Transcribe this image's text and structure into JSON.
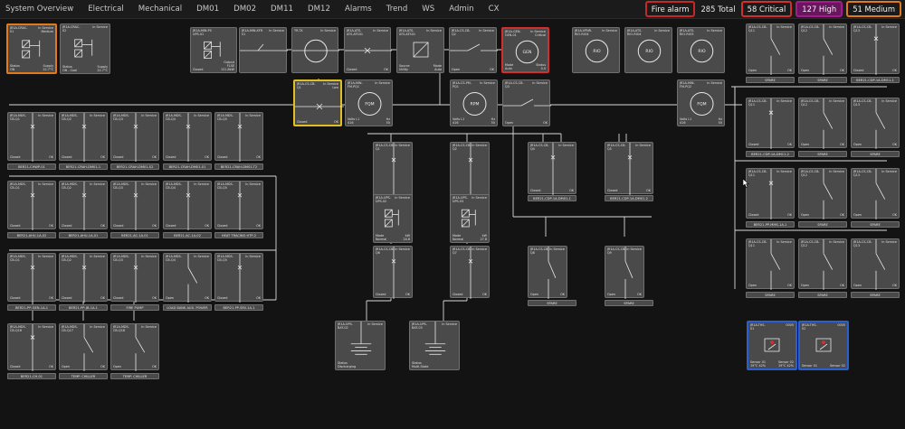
{
  "nav": {
    "items": [
      "System Overview",
      "Electrical",
      "Mechanical",
      "DM01",
      "DM02",
      "DM11",
      "DM12",
      "Alarms",
      "Trend",
      "WS",
      "Admin",
      "CX"
    ]
  },
  "alarms": {
    "fire": "Fire alarm",
    "total": "285 Total",
    "critical": "58 Critical",
    "high": "127 High",
    "medium": "51 Medium"
  },
  "colors": {
    "background": "#131313",
    "tile": "#4a4a4a",
    "wire": "#d8d8d8",
    "critical": "#d32f2f",
    "high": "#a01d8a",
    "medium": "#e07a1a",
    "selected": "#e0c020",
    "sensor": "#2a5fd0"
  },
  "common": {
    "in_service": "In Service",
    "closed": "Closed",
    "open": "Open",
    "ok": "OK",
    "spare": "SPARE"
  },
  "tiles": {
    "crac1": {
      "title": "JR1A-CRAC-\n01",
      "status": "In Service\nMedium",
      "bl": "Status\nON",
      "br": "Supply\n22.7°C"
    },
    "crac2": {
      "title": "JR1A-CRAC-\n02",
      "status": "In Service",
      "bl": "Status\nON - Cool",
      "br": "Supply\n22.7°C"
    },
    "ups": {
      "title": "JR1A-MIN-PS\nUPS-01",
      "status": "",
      "bl": "Closed",
      "br": "Output\nFLSE\n121.8kW"
    },
    "xfmr": {
      "title": "JR1A-MIN-XFR\n01",
      "status": "In Service",
      "bl": "",
      "br": ""
    },
    "tx": {
      "title": "TR-TX",
      "status": "In Service",
      "bl": "",
      "br": ""
    },
    "ats": {
      "title": "JR1A-ATS-\nATS-ATS01",
      "status": "In Service",
      "bl": "Closed",
      "br": "OK"
    },
    "ats2": {
      "title": "JR1A-ATS-\nATS-ATS01",
      "status": "In Service",
      "bl": "Source\nUtility",
      "br": "Mode\nAuto"
    },
    "cbq2": {
      "title": "JR1A-CS-CB-\nQ2",
      "status": "In Service",
      "bl": "Open",
      "br": "OK"
    },
    "gen": {
      "title": "JR1A-GEN-\nGEN-01",
      "status": "In Service\nCritical",
      "bl": "Mode\nAuto",
      "br": "Status\n0.0"
    },
    "rio1": {
      "title": "JR1A-VPNR-\nRIO-RIO4",
      "status": "In Service"
    },
    "rio2": {
      "title": "JR1A-ATS-\nRIO-RIO4",
      "status": "In Service"
    },
    "rio3": {
      "title": "JR1A-ATS-\nRIO-RIO5",
      "status": "In Service"
    },
    "cbq1": {
      "title": "JR1A-CS-CB-\nQ1",
      "status": "In Service\nLow",
      "bl": "Closed",
      "br": "OK"
    },
    "fqm1": {
      "title": "JR1A-MIN-\nFM-PQ1",
      "status": "In Service",
      "bl": "Volts L1\n416",
      "br": "Hz\n50"
    },
    "rpm": {
      "title": "JR1A-CS-PM-\nPQ1",
      "status": "In Service",
      "bl": "Volts L1\n416",
      "br": "Hz\n50"
    },
    "cbq3": {
      "title": "JR1A-CS-CB-\nQ3",
      "status": "In Service",
      "bl": "Open",
      "br": "OK"
    },
    "fqm2": {
      "title": "JR1A-MIN-\nFM-PQ2",
      "status": "In Service",
      "bl": "Volts L1\n416",
      "br": "Hz\n50"
    },
    "ups2a": {
      "title": "JR1A-UPS-\nUPS-02",
      "status": "In Service",
      "bl": "Mode\nNormal",
      "br": "kW\n24.6"
    },
    "ups2b": {
      "title": "JR1A-UPS-\nUPS-03",
      "status": "In Service",
      "bl": "Mode\nNormal",
      "br": "kW\n27.8"
    },
    "ups3a": {
      "title": "JR1A-UPS-\nBAT-02",
      "status": "In Service",
      "bl": "Status\nDischarging",
      "br": ""
    },
    "ups3b": {
      "title": "JR1A-UPS-\nBAT-03",
      "status": "In Service",
      "bl": "Status\nMulti-State",
      "br": ""
    },
    "sensor1": {
      "title": "JR1A-THS-\n01",
      "status": "0005",
      "bl": "Sensor 01\n19°C 42%",
      "br": "Sensor 02\n19°C 42%"
    },
    "sensor2": {
      "title": "JR1A-THS-\n02",
      "status": "0005",
      "bl": "Sensor 01",
      "br": "Sensor 02"
    }
  },
  "labels": {
    "row1": [
      "BER21-CHWP-01",
      "BER21-CRAH-DM01-1",
      "BER21-CRAH-DM01-S2",
      "BER21-CRAH-DM01-01",
      "BER21-CRAH-DM01-T2"
    ],
    "row2": [
      "BER21-AHU-1A-02",
      "BER21-AHU-1A-01",
      "BER21-AC-1A-01",
      "BER21-AC-1A-02",
      "HEAT TRACING HTP-2"
    ],
    "row3": [
      "BER21-PP-GEN-1A-1",
      "BER21-PP-JB-1A-1",
      "FIRE PUMP",
      "LOAD BANK AUX. POWER",
      "BER21-PP-SRV-1A-1"
    ],
    "row4": [
      "BER21-CH-01",
      "TEMP. CHILLER",
      "TEMP. CHILLER"
    ],
    "center_a": [
      "BER21-CDP-1A-DM01-1",
      "BER21-CDP-1A-DM01-2"
    ],
    "center_spare": [
      "SPARE",
      "SPARE"
    ],
    "right1": [
      "SPARE",
      "SPARE",
      "BER21-CDP-1A-DM11-1"
    ],
    "right2": [
      "BER21-CDP-1A-DM11-2",
      "SPARE",
      "SPARE"
    ],
    "right3": [
      "BER21-PP-MMS-1A-1",
      "SPARE",
      "SPARE"
    ],
    "right4": [
      "SPARE",
      "SPARE",
      "SPARE"
    ]
  },
  "icons": {
    "breaker": "breaker-icon",
    "generator": "generator-icon",
    "ups": "ups-icon",
    "battery": "battery-icon",
    "sensor": "sensor-icon",
    "meter": "meter-icon"
  },
  "rio_label": "RIO",
  "gen_label": "GEN",
  "fqm_label": "FQM",
  "rpm_label": "RPM"
}
